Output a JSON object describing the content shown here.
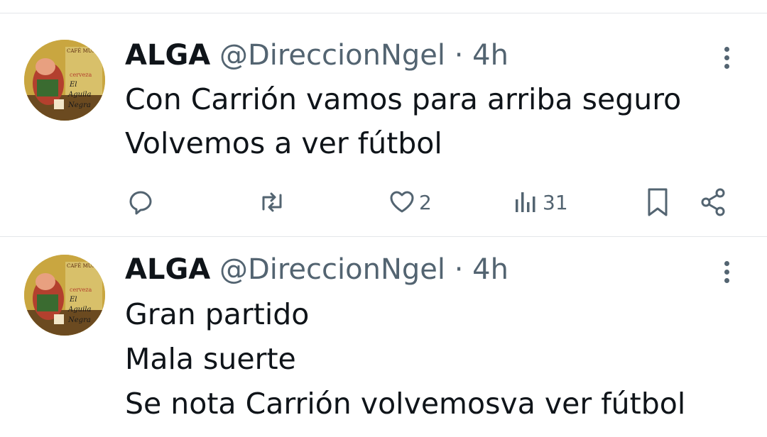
{
  "tweets": [
    {
      "name": "ALGA",
      "handle": "@DireccionNgel",
      "separator": "·",
      "time": "4h",
      "lines": [
        "Con Carrión vamos para arriba seguro",
        "Volvemos a ver fútbol"
      ],
      "avatar_text": [
        "CAFÉ MUNICH",
        "cerveza",
        "El",
        "Aguila",
        "Negra"
      ],
      "actions": {
        "reply_icon": "reply-icon",
        "retweet_icon": "retweet-icon",
        "like_icon": "heart-icon",
        "like_count": "2",
        "views_icon": "views-icon",
        "views_count": "31",
        "bookmark_icon": "bookmark-icon",
        "share_icon": "share-icon"
      }
    },
    {
      "name": "ALGA",
      "handle": "@DireccionNgel",
      "separator": "·",
      "time": "4h",
      "lines": [
        "Gran partido",
        "Mala suerte",
        "Se nota Carrión volvemosva ver fútbol"
      ],
      "avatar_text": [
        "CAFÉ MUNICH",
        "cerveza",
        "El",
        "Aguila",
        "Negra"
      ]
    }
  ],
  "colors": {
    "text": "#0f1419",
    "secondary": "#536471",
    "divider": "#e3e6e9"
  }
}
